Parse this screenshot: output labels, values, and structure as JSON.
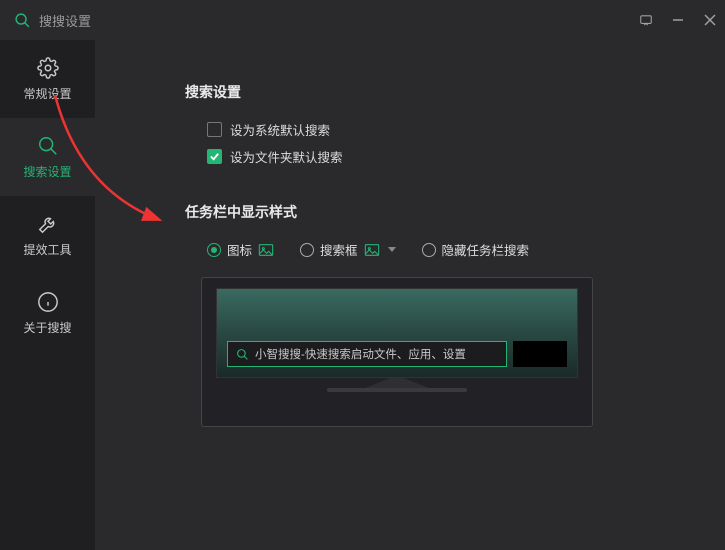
{
  "title": "搜搜设置",
  "sidebar": {
    "items": [
      {
        "label": "常规设置"
      },
      {
        "label": "搜索设置"
      },
      {
        "label": "提效工具"
      },
      {
        "label": "关于搜搜"
      }
    ],
    "activeIndex": 1
  },
  "sections": {
    "search": {
      "heading": "搜索设置",
      "opt_default_search": {
        "label": "设为系统默认搜索",
        "checked": false
      },
      "opt_folder_search": {
        "label": "设为文件夹默认搜索",
        "checked": true
      }
    },
    "taskbar": {
      "heading": "任务栏中显示样式",
      "options": {
        "icon": {
          "label": "图标"
        },
        "box": {
          "label": "搜索框"
        },
        "hide": {
          "label": "隐藏任务栏搜索"
        }
      },
      "selected": "icon",
      "preview_placeholder": "小智搜搜-快速搜索启动文件、应用、设置"
    }
  },
  "colors": {
    "accent": "#23b574"
  }
}
